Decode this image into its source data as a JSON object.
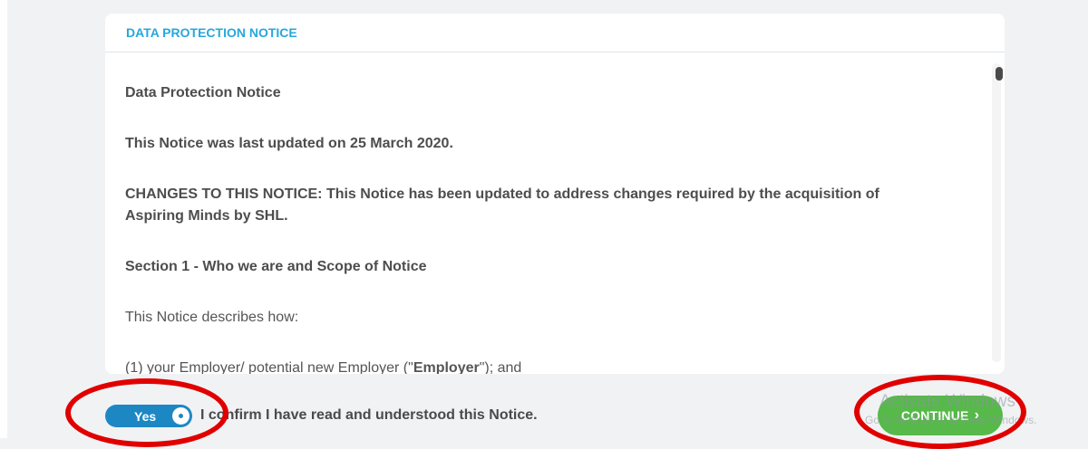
{
  "dialog": {
    "header_title": "DATA PROTECTION NOTICE",
    "paragraphs": {
      "title": "Data Protection Notice",
      "updated": "This Notice was last updated on 25 March 2020.",
      "changes_line1": "CHANGES TO THIS NOTICE: This Notice has been updated to address changes required by the acquisition of",
      "changes_line2": "Aspiring Minds by SHL.",
      "section1": "Section 1 - Who we are and Scope of Notice",
      "describes": "This Notice describes how:",
      "employer_prefix": "(1) your Employer/ potential new Employer (\"",
      "employer_bold": "Employer",
      "employer_suffix": "\"); and"
    }
  },
  "footer": {
    "toggle_label": "Yes",
    "toggle_state": "on",
    "confirm_text": "I confirm I have read and understood this Notice.",
    "continue_label": "CONTINUE",
    "continue_icon": "chevron-right-icon"
  },
  "watermark": {
    "title": "Activate Windows",
    "subtitle": "Go to Settings to activate Windows."
  },
  "colors": {
    "header_accent": "#27a7dd",
    "toggle": "#1d87c4",
    "continue": "#56b949",
    "annotation": "#e00000"
  }
}
